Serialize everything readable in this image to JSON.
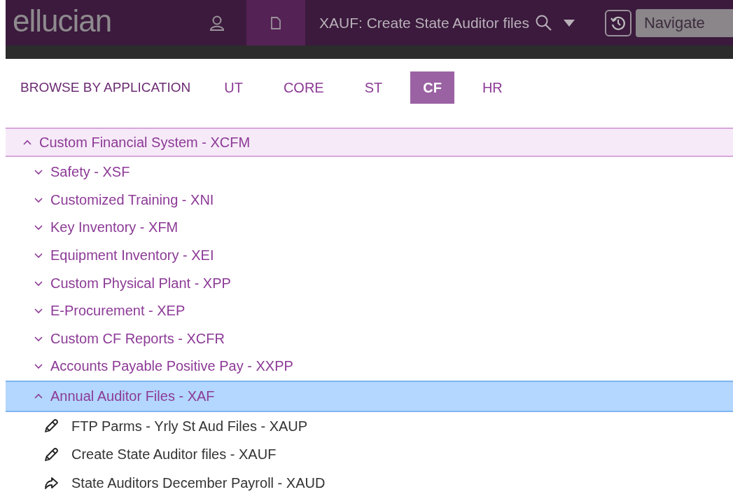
{
  "header": {
    "logo": "ellucian",
    "page_title": "XAUF: Create State Auditor files",
    "navigate": "Navigate"
  },
  "browse": {
    "label": "BROWSE BY APPLICATION",
    "tabs": [
      {
        "label": "UT",
        "selected": false
      },
      {
        "label": "CORE",
        "selected": false
      },
      {
        "label": "ST",
        "selected": false
      },
      {
        "label": "CF",
        "selected": true
      },
      {
        "label": "HR",
        "selected": false
      }
    ]
  },
  "tree": [
    {
      "label": "Custom Financial System - XCFM",
      "expanded": true,
      "selected": false,
      "children": [
        {
          "label": "Safety - XSF",
          "expanded": false,
          "selected": false
        },
        {
          "label": "Customized Training - XNI",
          "expanded": false,
          "selected": false
        },
        {
          "label": "Key Inventory - XFM",
          "expanded": false,
          "selected": false
        },
        {
          "label": "Equipment Inventory - XEI",
          "expanded": false,
          "selected": false
        },
        {
          "label": "Custom Physical Plant - XPP",
          "expanded": false,
          "selected": false
        },
        {
          "label": "E-Procurement - XEP",
          "expanded": false,
          "selected": false
        },
        {
          "label": "Custom CF Reports - XCFR",
          "expanded": false,
          "selected": false
        },
        {
          "label": "Accounts Payable Positive Pay - XXPP",
          "expanded": false,
          "selected": false
        },
        {
          "label": "Annual Auditor Files - XAF",
          "expanded": true,
          "selected": true,
          "children": [
            {
              "label": "FTP Parms - Yrly St Aud Files - XAUP",
              "kind": "form"
            },
            {
              "label": "Create State Auditor files - XAUF",
              "kind": "form"
            },
            {
              "label": "State Auditors December Payroll - XAUD",
              "kind": "link"
            }
          ]
        }
      ]
    }
  ]
}
